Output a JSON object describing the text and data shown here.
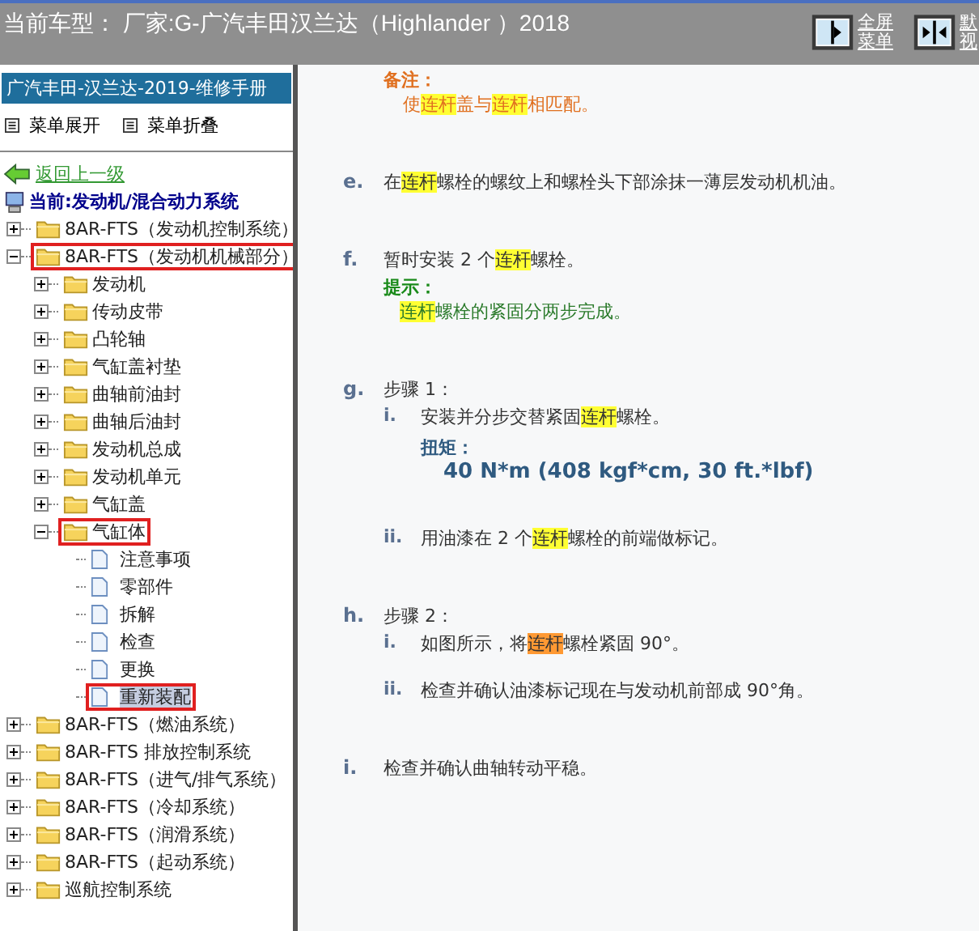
{
  "header": {
    "title": "当前车型： 厂家:G-广汽丰田汉兰达（Highlander ）2018",
    "buttons": [
      {
        "kind": "fullscreen",
        "lines": [
          "全屏",
          "菜单"
        ]
      },
      {
        "kind": "split",
        "lines": [
          "默",
          "视"
        ]
      }
    ]
  },
  "sidebar": {
    "title": "广汽丰田-汉兰达-2019-维修手册",
    "menu": [
      "菜单展开",
      "菜单折叠"
    ],
    "back_link": "返回上一级",
    "current": "当前:发动机/混合动力系统",
    "tree": [
      {
        "label": "8AR-FTS（发动机控制系统）",
        "kind": "folder",
        "expanded": false,
        "selected": false,
        "marked": false
      },
      {
        "label": "8AR-FTS（发动机机械部分）",
        "kind": "folder",
        "expanded": true,
        "selected": false,
        "marked": true,
        "children": [
          {
            "label": "发动机",
            "kind": "folder",
            "expanded": false,
            "selected": false,
            "marked": false
          },
          {
            "label": "传动皮带",
            "kind": "folder",
            "expanded": false,
            "selected": false,
            "marked": false
          },
          {
            "label": "凸轮轴",
            "kind": "folder",
            "expanded": false,
            "selected": false,
            "marked": false
          },
          {
            "label": "气缸盖衬垫",
            "kind": "folder",
            "expanded": false,
            "selected": false,
            "marked": false
          },
          {
            "label": "曲轴前油封",
            "kind": "folder",
            "expanded": false,
            "selected": false,
            "marked": false
          },
          {
            "label": "曲轴后油封",
            "kind": "folder",
            "expanded": false,
            "selected": false,
            "marked": false
          },
          {
            "label": "发动机总成",
            "kind": "folder",
            "expanded": false,
            "selected": false,
            "marked": false
          },
          {
            "label": "发动机单元",
            "kind": "folder",
            "expanded": false,
            "selected": false,
            "marked": false
          },
          {
            "label": "气缸盖",
            "kind": "folder",
            "expanded": false,
            "selected": false,
            "marked": false
          },
          {
            "label": "气缸体",
            "kind": "folder",
            "expanded": true,
            "selected": false,
            "marked": true,
            "children": [
              {
                "label": "注意事项",
                "kind": "page",
                "selected": false,
                "marked": false
              },
              {
                "label": "零部件",
                "kind": "page",
                "selected": false,
                "marked": false
              },
              {
                "label": "拆解",
                "kind": "page",
                "selected": false,
                "marked": false
              },
              {
                "label": "检查",
                "kind": "page",
                "selected": false,
                "marked": false
              },
              {
                "label": "更换",
                "kind": "page",
                "selected": false,
                "marked": false
              },
              {
                "label": "重新装配",
                "kind": "page",
                "selected": true,
                "marked": true
              }
            ]
          }
        ]
      },
      {
        "label": "8AR-FTS（燃油系统）",
        "kind": "folder",
        "expanded": false,
        "selected": false,
        "marked": false
      },
      {
        "label": "8AR-FTS 排放控制系统",
        "kind": "folder",
        "expanded": false,
        "selected": false,
        "marked": false
      },
      {
        "label": "8AR-FTS（进气/排气系统）",
        "kind": "folder",
        "expanded": false,
        "selected": false,
        "marked": false
      },
      {
        "label": "8AR-FTS（冷却系统）",
        "kind": "folder",
        "expanded": false,
        "selected": false,
        "marked": false
      },
      {
        "label": "8AR-FTS（润滑系统）",
        "kind": "folder",
        "expanded": false,
        "selected": false,
        "marked": false
      },
      {
        "label": "8AR-FTS（起动系统）",
        "kind": "folder",
        "expanded": false,
        "selected": false,
        "marked": false
      },
      {
        "label": "巡航控制系统",
        "kind": "folder",
        "expanded": false,
        "selected": false,
        "marked": false
      }
    ]
  },
  "content": {
    "note": {
      "label": "备注：",
      "text": [
        {
          "text": "使"
        },
        {
          "text": "连杆",
          "color": "#ffff33"
        },
        {
          "text": "盖与"
        },
        {
          "text": "连杆",
          "color": "#ffff33"
        },
        {
          "text": "相匹配。"
        }
      ]
    },
    "steps": [
      {
        "marker": "e.",
        "text": [
          {
            "text": "在"
          },
          {
            "text": "连杆",
            "color": "#ffff33"
          },
          {
            "text": "螺栓的螺纹上和螺栓头下部涂抹一薄层发动机机油。"
          }
        ]
      },
      {
        "marker": "f.",
        "text": [
          {
            "text": "暂时安装 2 个"
          },
          {
            "text": "连杆",
            "color": "#ffff33"
          },
          {
            "text": "螺栓。"
          }
        ],
        "hint": {
          "label": "提示：",
          "text": [
            {
              "text": "连杆",
              "color": "#ffff33"
            },
            {
              "text": "螺栓的紧固分两步完成。"
            }
          ]
        }
      },
      {
        "marker": "g.",
        "text": [
          {
            "text": "步骤 1："
          }
        ],
        "substeps": [
          {
            "marker": "i.",
            "text": [
              {
                "text": "安装并分步交替紧固"
              },
              {
                "text": "连杆",
                "color": "#ffff33"
              },
              {
                "text": "螺栓。"
              }
            ],
            "torque": {
              "label": "扭矩：",
              "value": "40 N*m (408 kgf*cm, 30 ft.*lbf)"
            }
          },
          {
            "marker": "ii.",
            "text": [
              {
                "text": "用油漆在 2 个"
              },
              {
                "text": "连杆",
                "color": "#ffff33"
              },
              {
                "text": "螺栓的前端做标记。"
              }
            ]
          }
        ]
      },
      {
        "marker": "h.",
        "text": [
          {
            "text": "步骤 2："
          }
        ],
        "substeps": [
          {
            "marker": "i.",
            "text": [
              {
                "text": "如图所示，将"
              },
              {
                "text": "连杆",
                "color": "#ff9933"
              },
              {
                "text": "螺栓紧固 90°。"
              }
            ]
          },
          {
            "marker": "ii.",
            "text": [
              {
                "text": "检查并确认油漆标记现在与发动机前部成 90°角。"
              }
            ]
          }
        ]
      },
      {
        "marker": "i.",
        "text": [
          {
            "text": "检查并确认曲轴转动平稳。"
          }
        ]
      }
    ]
  }
}
